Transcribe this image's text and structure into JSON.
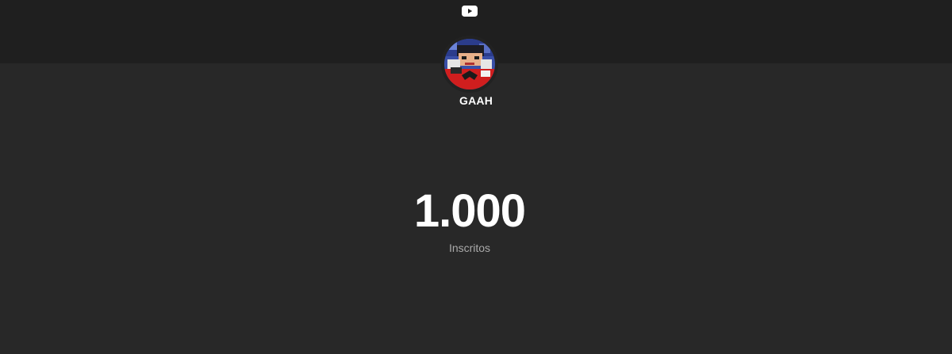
{
  "header": {
    "logo_icon": "youtube-play-icon",
    "logo_color": "#ffffff",
    "background": "#1f1f1f"
  },
  "channel": {
    "name": "GAAH",
    "avatar_icon": "channel-avatar"
  },
  "stats": {
    "subscriber_count": "1.000",
    "subscriber_label": "Inscritos"
  },
  "colors": {
    "page_background": "#282828",
    "primary_text": "#ffffff",
    "secondary_text": "#aaaaaa"
  }
}
